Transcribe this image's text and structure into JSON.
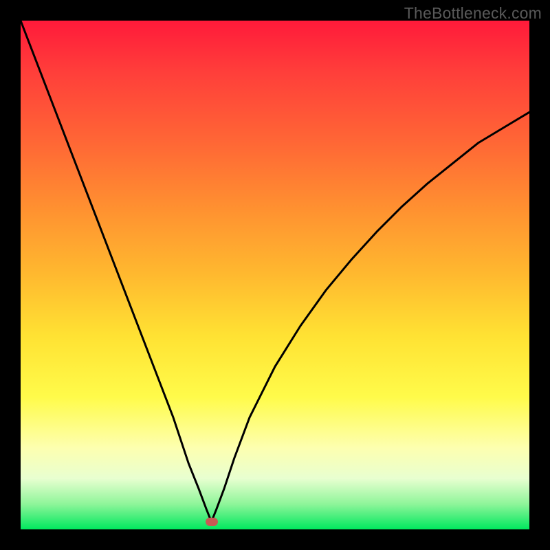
{
  "watermark": "TheBottleneck.com",
  "chart_data": {
    "type": "line",
    "title": "",
    "xlabel": "",
    "ylabel": "",
    "xlim": [
      0,
      100
    ],
    "ylim": [
      0,
      100
    ],
    "grid": false,
    "legend": false,
    "background": "red-yellow-green vertical gradient",
    "marker": {
      "x": 37.5,
      "y": 1.5,
      "color": "#c85a54"
    },
    "series": [
      {
        "name": "bottleneck-curve",
        "color": "#000000",
        "x": [
          0,
          5,
          10,
          15,
          20,
          25,
          30,
          33,
          35,
          36.5,
          37.5,
          38.5,
          40,
          42,
          45,
          50,
          55,
          60,
          65,
          70,
          75,
          80,
          85,
          90,
          95,
          100
        ],
        "values": [
          100,
          87,
          74,
          61,
          48,
          35,
          22,
          13,
          8,
          4,
          1.5,
          4,
          8,
          14,
          22,
          32,
          40,
          47,
          53,
          58.5,
          63.5,
          68,
          72,
          76,
          79,
          82
        ]
      }
    ]
  }
}
